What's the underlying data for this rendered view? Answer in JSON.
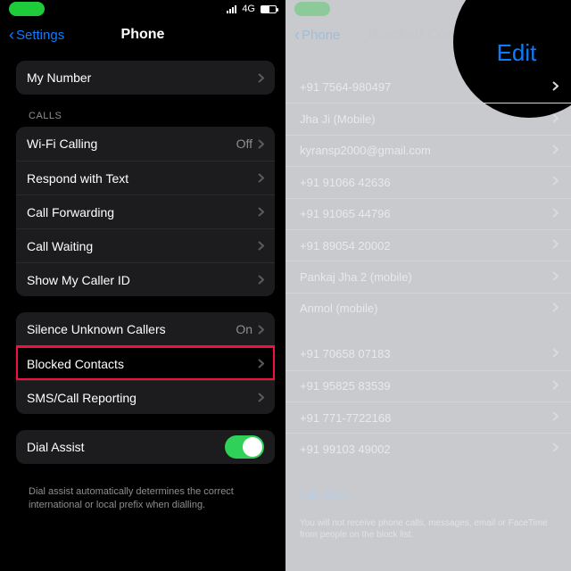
{
  "left": {
    "statusbar": {
      "network_label": "4G"
    },
    "nav": {
      "back": "Settings",
      "title": "Phone"
    },
    "group_mynumber": {
      "label": "My Number"
    },
    "section_calls_header": "CALLS",
    "calls": [
      {
        "label": "Wi-Fi Calling",
        "aux": "Off"
      },
      {
        "label": "Respond with Text"
      },
      {
        "label": "Call Forwarding"
      },
      {
        "label": "Call Waiting"
      },
      {
        "label": "Show My Caller ID"
      }
    ],
    "group_block": [
      {
        "label": "Silence Unknown Callers",
        "aux": "On"
      },
      {
        "label": "Blocked Contacts",
        "highlight": true
      },
      {
        "label": "SMS/Call Reporting"
      }
    ],
    "dial_assist": {
      "label": "Dial Assist",
      "on": true
    },
    "dial_assist_footnote": "Dial assist automatically determines the correct international or local prefix when dialling."
  },
  "right": {
    "nav": {
      "back": "Phone",
      "title": "Blocked Contacts",
      "edit": "Edit"
    },
    "contacts": [
      "+91 7564-980497",
      "Jha Ji (Mobile)",
      "kyransp2000@gmail.com",
      "+91 91066 42636",
      "+91 91065 44796",
      "+91 89054 20002",
      "Pankaj Jha 2 (mobile)",
      "Anmol (mobile)",
      "+91 70658 07183",
      "+91 95825 83539",
      "+91 771-7722168",
      "+91 99103 49002"
    ],
    "add_new_label": "Add New...",
    "footnote": "You will not receive phone calls, messages, email or FaceTime from people on the block list."
  }
}
